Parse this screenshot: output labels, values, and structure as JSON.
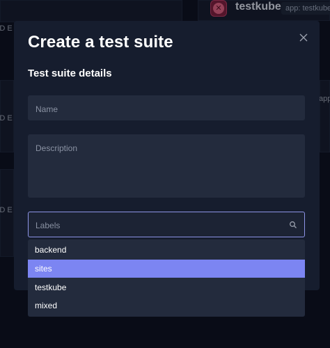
{
  "background": {
    "app_name": "testkube",
    "tag": "app: testkube",
    "tag_right": "app",
    "left_snippets": [
      "ED E",
      "ED E",
      "ED E"
    ]
  },
  "modal": {
    "title": "Create a test suite",
    "close_icon": "close-icon",
    "section_title": "Test suite details",
    "name_placeholder": "Name",
    "description_placeholder": "Description",
    "labels_placeholder": "Labels",
    "labels_icon": "search-icon",
    "dropdown": {
      "options": [
        "backend",
        "sites",
        "testkube",
        "mixed"
      ],
      "selected": "sites"
    }
  },
  "colors": {
    "accent": "#7c85f2",
    "focus_border": "#8e95e8",
    "modal_bg": "#161d2e",
    "field_bg": "#232b3d"
  }
}
